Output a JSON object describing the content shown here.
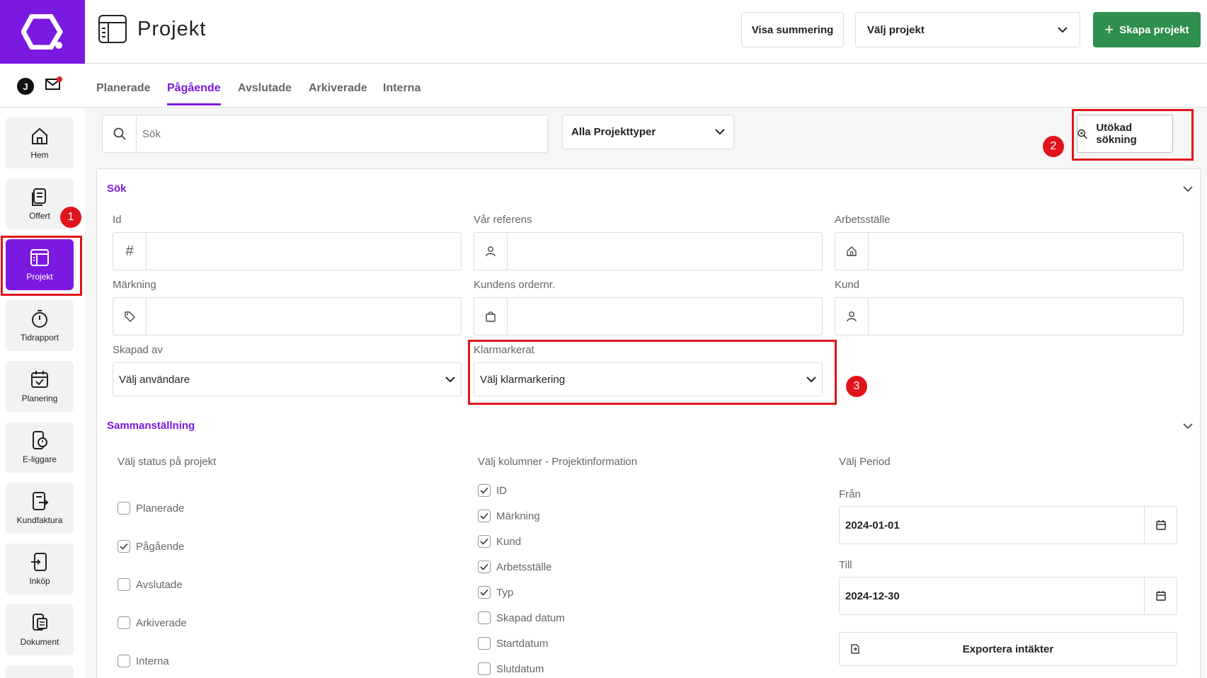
{
  "header": {
    "title": "Projekt",
    "summary_button": "Visa summering",
    "project_select": "Välj projekt",
    "create_button": "Skapa projekt"
  },
  "user": {
    "initial": "J"
  },
  "tabs": [
    "Planerade",
    "Pågående",
    "Avslutade",
    "Arkiverade",
    "Interna"
  ],
  "active_tab": "Pågående",
  "sidebar": {
    "items": [
      {
        "label": "Hem",
        "icon": "home-icon"
      },
      {
        "label": "Offert",
        "icon": "offer-icon"
      },
      {
        "label": "Projekt",
        "icon": "project-icon"
      },
      {
        "label": "Tidrapport",
        "icon": "stopwatch-icon"
      },
      {
        "label": "Planering",
        "icon": "calendar-check-icon"
      },
      {
        "label": "E-liggare",
        "icon": "phone-clock-icon"
      },
      {
        "label": "Kundfaktura",
        "icon": "invoice-icon"
      },
      {
        "label": "Inköp",
        "icon": "purchase-icon"
      },
      {
        "label": "Dokument",
        "icon": "document-icon"
      }
    ],
    "active": "Projekt"
  },
  "search": {
    "placeholder": "Sök",
    "type_select": "Alla Projekttyper",
    "advanced_button": "Utökad sökning"
  },
  "filters": {
    "section_title": "Sök",
    "id_label": "Id",
    "reference_label": "Vår referens",
    "workplace_label": "Arbetsställe",
    "marking_label": "Märkning",
    "order_label": "Kundens ordernr.",
    "customer_label": "Kund",
    "created_by_label": "Skapad av",
    "created_by_value": "Välj användare",
    "done_label": "Klarmarkerat",
    "done_value": "Välj klarmarkering"
  },
  "summary": {
    "section_title": "Sammanställning",
    "status_heading": "Välj status på projekt",
    "statuses": [
      {
        "label": "Planerade",
        "checked": false
      },
      {
        "label": "Pågående",
        "checked": true
      },
      {
        "label": "Avslutade",
        "checked": false
      },
      {
        "label": "Arkiverade",
        "checked": false
      },
      {
        "label": "Interna",
        "checked": false
      }
    ],
    "columns_heading": "Välj kolumner - Projektinformation",
    "columns": [
      {
        "label": "ID",
        "checked": true
      },
      {
        "label": "Märkning",
        "checked": true
      },
      {
        "label": "Kund",
        "checked": true
      },
      {
        "label": "Arbetsställe",
        "checked": true
      },
      {
        "label": "Typ",
        "checked": true
      },
      {
        "label": "Skapad datum",
        "checked": false
      },
      {
        "label": "Startdatum",
        "checked": false
      },
      {
        "label": "Slutdatum",
        "checked": false
      }
    ],
    "period_heading": "Välj Period",
    "from_label": "Från",
    "from_value": "2024-01-01",
    "to_label": "Till",
    "to_value": "2024-12-30",
    "export_button": "Exportera intäkter"
  },
  "annotations": [
    "1",
    "2",
    "3"
  ],
  "colors": {
    "brand": "#7b19e0",
    "create": "#2f8f4e",
    "annotation": "#e0141c"
  }
}
